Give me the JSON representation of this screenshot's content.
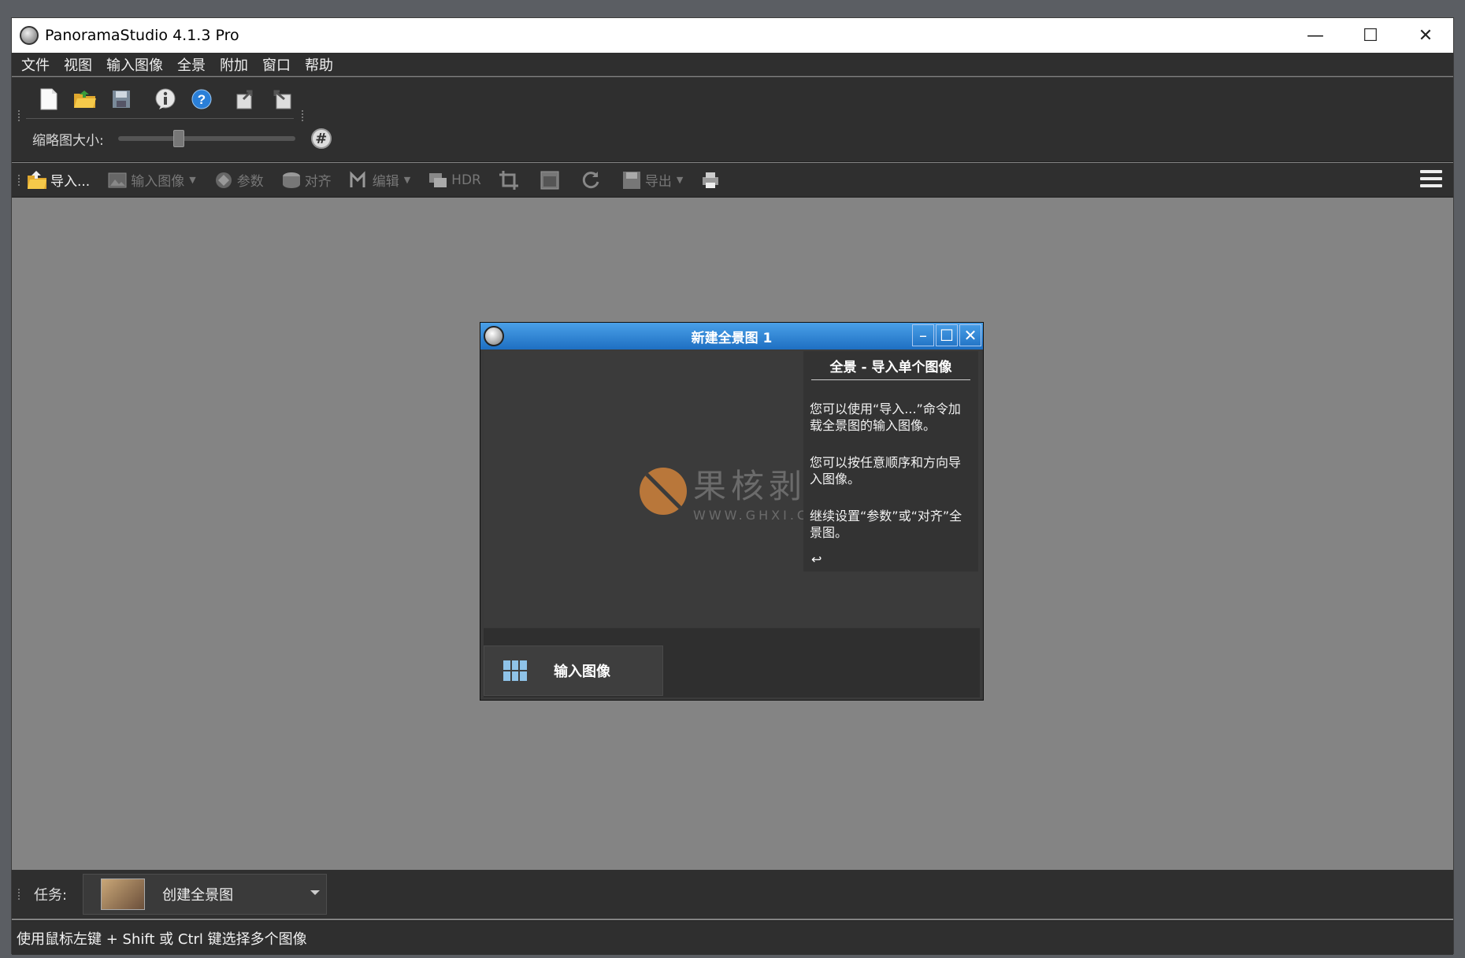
{
  "window": {
    "title": "PanoramaStudio 4.1.3 Pro",
    "minimize": "—",
    "maximize": "☐",
    "close": "✕"
  },
  "menu": [
    "文件",
    "视图",
    "输入图像",
    "全景",
    "附加",
    "窗口",
    "帮助"
  ],
  "thumb": {
    "label": "缩略图大小:",
    "grid_btn": "#"
  },
  "toolbar2": {
    "import": "导入...",
    "input_images": "输入图像",
    "params": "参数",
    "align": "对齐",
    "edit": "编辑",
    "hdr": "HDR",
    "export": "导出"
  },
  "dialog": {
    "title": "新建全景图 1",
    "min": "–",
    "help_title": "全景 - 导入单个图像",
    "help_p1": "您可以使用“导入...”命令加载全景图的输入图像。",
    "help_p2": "您可以按任意顺序和方向导入图像。",
    "help_p3": "继续设置“参数”或“对齐”全景图。",
    "help_arrow": "↩",
    "tab_label": "输入图像"
  },
  "watermark": {
    "big": "果核剥壳",
    "small": "WWW.GHXI.COM"
  },
  "task": {
    "label": "任务:",
    "value": "创建全景图"
  },
  "status": "使用鼠标左键 + Shift 或 Ctrl 键选择多个图像"
}
